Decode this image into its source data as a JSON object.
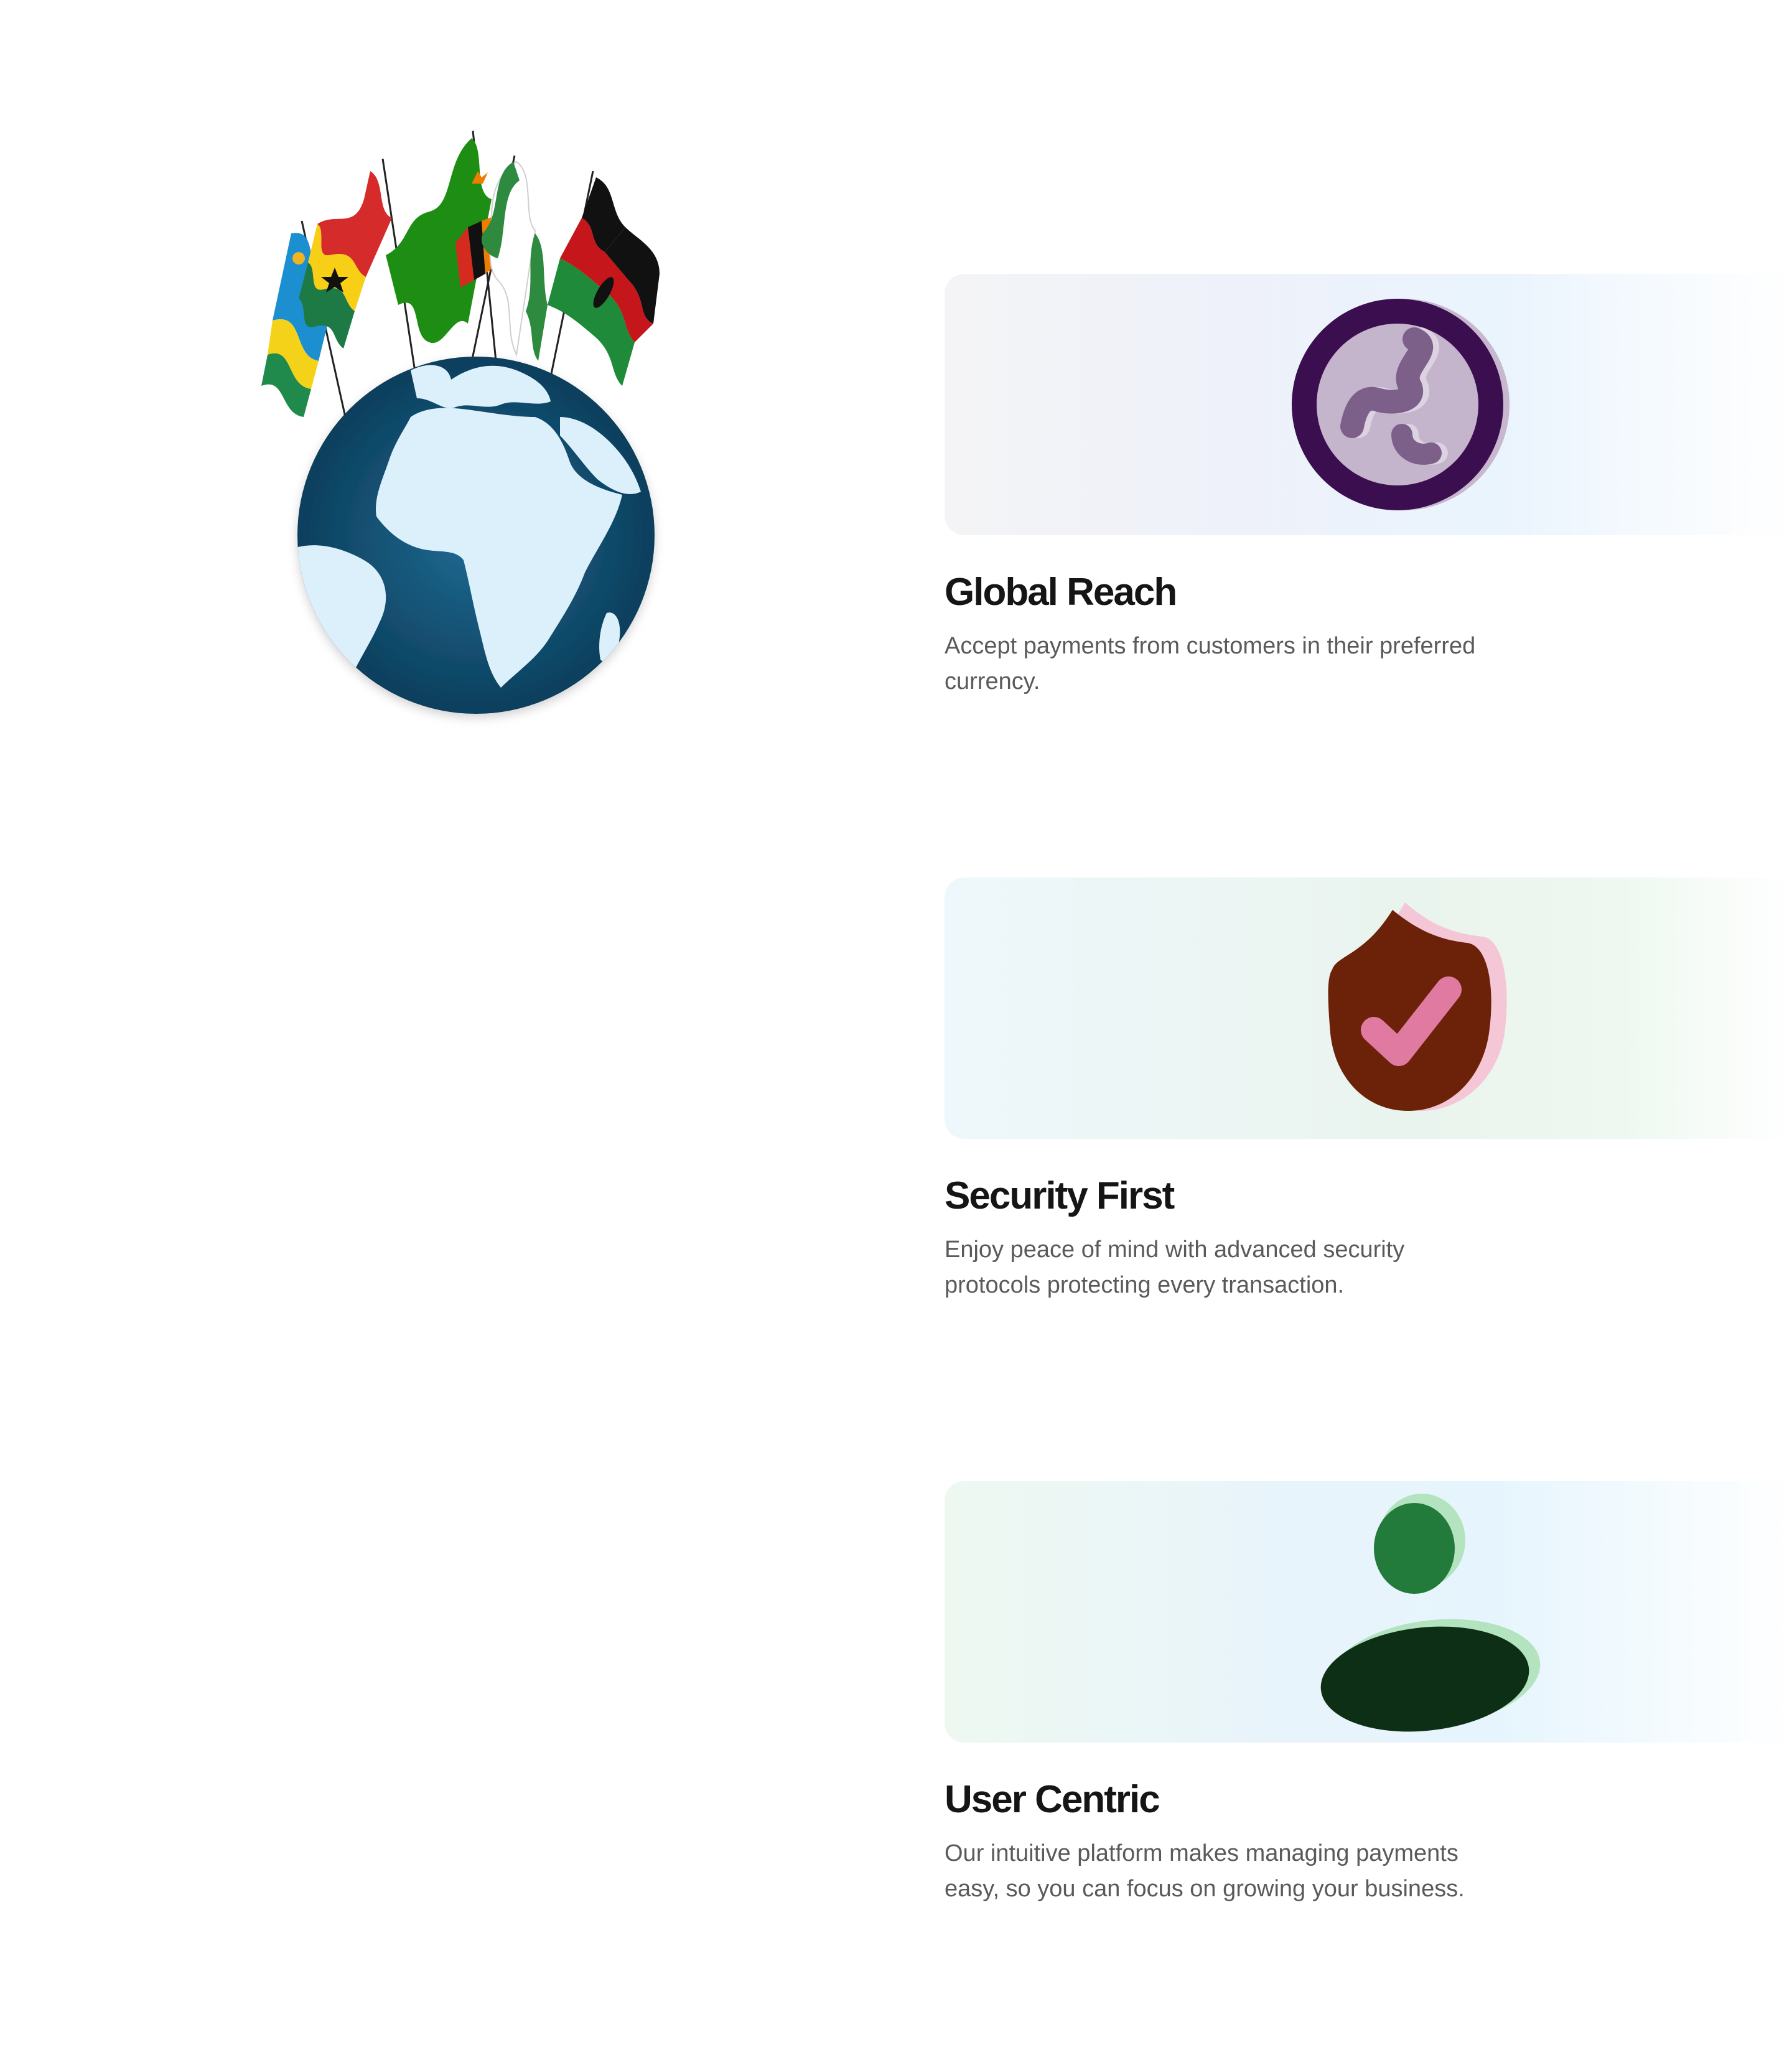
{
  "features": [
    {
      "title": "Global Reach",
      "description": "Accept payments from customers in their preferred currency.",
      "icon": "globe-swirl-icon",
      "accent": "#3b0f4f"
    },
    {
      "title": "Security First",
      "description": "Enjoy peace of mind with advanced security protocols protecting every transaction.",
      "icon": "shield-check-icon",
      "accent": "#6b2208"
    },
    {
      "title": "User Centric",
      "description": "Our intuitive platform makes managing payments easy, so you can focus on growing your business.",
      "icon": "user-icon",
      "accent": "#0d2f16"
    }
  ],
  "hero": {
    "icon": "globe-with-african-flags-icon",
    "flags": [
      "rwanda-flag-icon",
      "ghana-flag-icon",
      "zambia-flag-icon",
      "nigeria-flag-icon",
      "kenya-flag-icon"
    ]
  }
}
